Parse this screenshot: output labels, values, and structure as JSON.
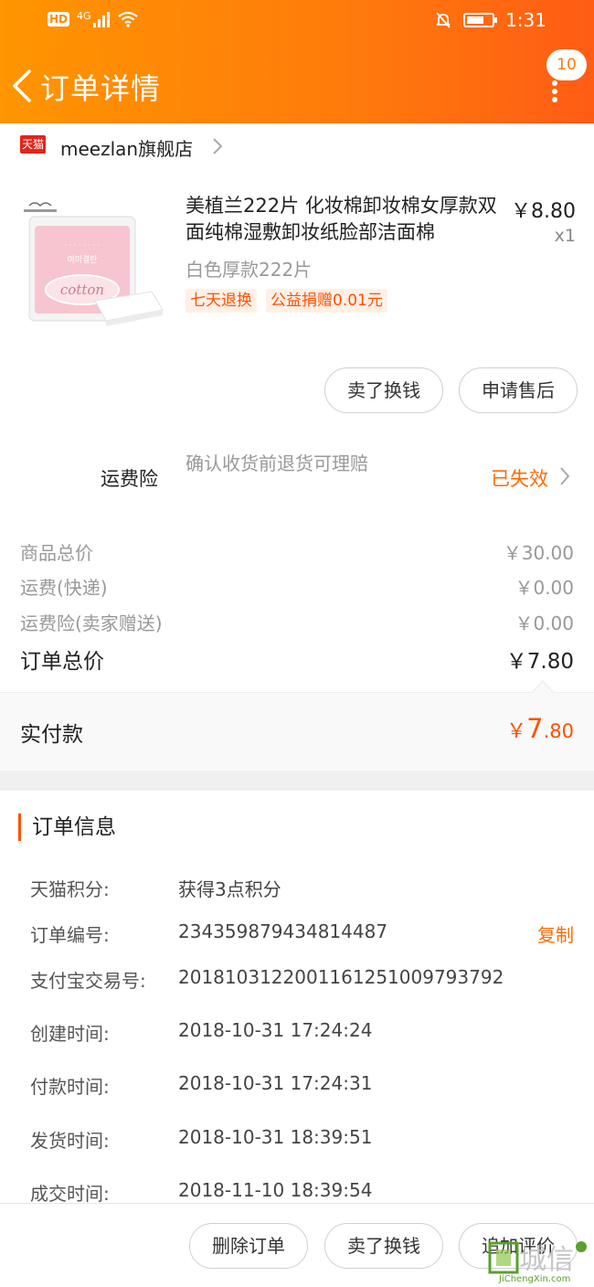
{
  "status_bar": {
    "hd": "HD",
    "network": "4G",
    "time": "1:31"
  },
  "nav": {
    "title": "订单详情",
    "message_count": "10"
  },
  "shop": {
    "platform_badge": "天猫",
    "name": "meezlan旗舰店"
  },
  "product": {
    "title": "美植兰222片 化妆棉卸妆棉女厚款双面纯棉湿敷卸妆纸脸部洁面棉",
    "price": "￥8.80",
    "quantity": "x1",
    "sku": "白色厚款222片",
    "tags": [
      "七天退换",
      "公益捐赠0.01元"
    ],
    "image_text": "cotton"
  },
  "product_actions": {
    "sell_label": "卖了换钱",
    "after_sale_label": "申请售后"
  },
  "insurance": {
    "label": "运费险",
    "description": "确认收货前退货可理赔",
    "status": "已失效"
  },
  "price_breakdown": [
    {
      "label": "商品总价",
      "value": "￥30.00"
    },
    {
      "label": "运费(快递)",
      "value": "￥0.00"
    },
    {
      "label": "运费险(卖家赠送)",
      "value": "￥0.00"
    }
  ],
  "order_total": {
    "label": "订单总价",
    "value": "￥7.80"
  },
  "paid": {
    "label": "实付款",
    "currency": "￥",
    "amount_int": "7",
    "amount_dec": ".80"
  },
  "order_info": {
    "title": "订单信息",
    "copy_label": "复制",
    "rows": [
      {
        "key": "天猫积分:",
        "value": "获得3点积分"
      },
      {
        "key": "订单编号:",
        "value": "234359879434814487"
      },
      {
        "key": "支付宝交易号:",
        "value": "2018103122001161251009793792"
      },
      {
        "key": "创建时间:",
        "value": "2018-10-31 17:24:24"
      },
      {
        "key": "付款时间:",
        "value": "2018-10-31 17:24:31"
      },
      {
        "key": "发货时间:",
        "value": "2018-10-31 18:39:51"
      },
      {
        "key": "成交时间:",
        "value": "2018-11-10 18:39:54"
      }
    ]
  },
  "bottom_actions": {
    "delete_label": "删除订单",
    "sell_label": "卖了换钱",
    "review_label": "追加评价"
  },
  "watermark": {
    "text": "城信",
    "site": "JiChengXin.com"
  },
  "colors": {
    "header_start": "#ff9500",
    "header_end": "#ff5c14",
    "accent": "#ff5000",
    "tmall_red": "#e1251b"
  }
}
